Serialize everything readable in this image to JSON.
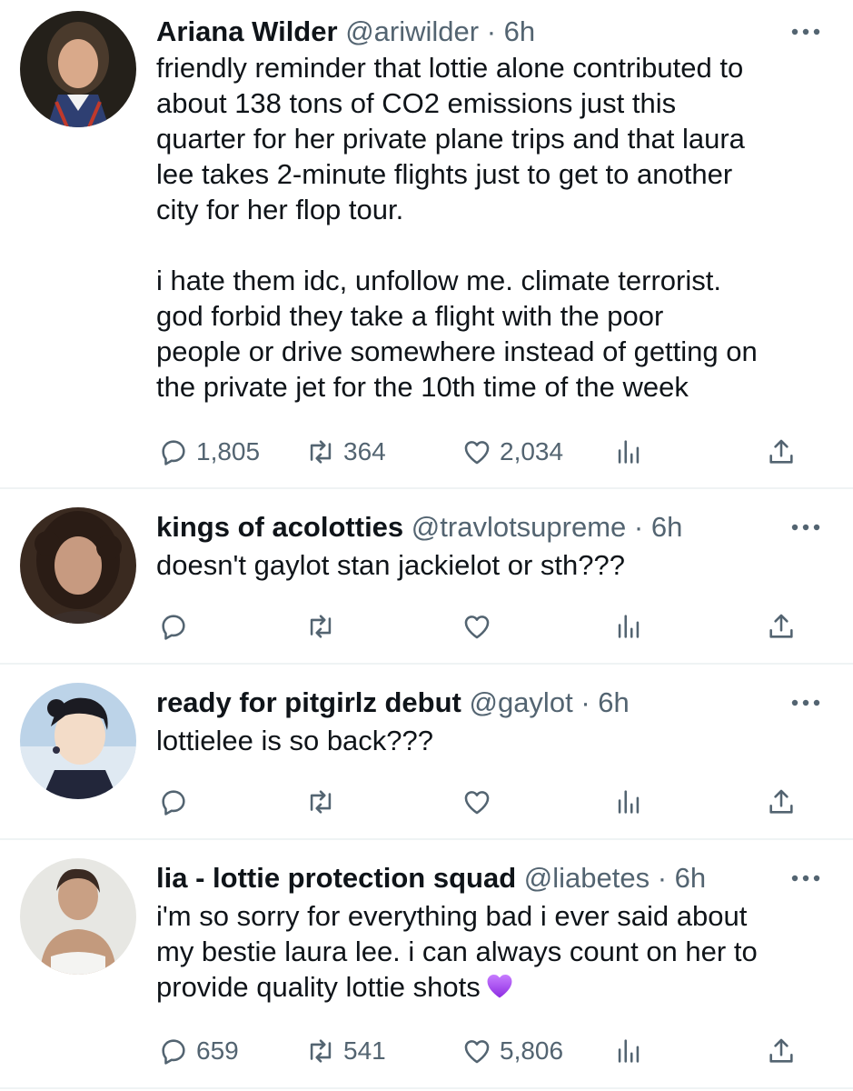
{
  "tweets": [
    {
      "name": "Ariana Wilder",
      "handle": "@ariwilder",
      "dot": "·",
      "time": "6h",
      "lines": [
        "friendly reminder that lottie alone contributed to",
        "about 138 tons of CO2 emissions just this",
        "quarter for her private plane trips and that laura",
        "lee takes 2-minute flights just to get to another",
        "city for her flop tour.",
        "",
        "i hate them idc, unfollow me. climate terrorist.",
        "god forbid they take a flight with the poor",
        "people or drive somewhere instead of getting on",
        "the private jet for the 10th time of the week"
      ],
      "replies": "1,805",
      "retweets": "364",
      "likes": "2,034"
    },
    {
      "name": "kings of acolotties",
      "handle": "@travlotsupreme",
      "dot": "·",
      "time": "6h",
      "lines": [
        "doesn't gaylot stan jackielot or sth???"
      ],
      "replies": "",
      "retweets": "",
      "likes": ""
    },
    {
      "name": "ready for pitgirlz debut",
      "handle": "@gaylot",
      "dot": "·",
      "time": "6h",
      "lines": [
        "lottielee is so back???"
      ],
      "replies": "",
      "retweets": "",
      "likes": ""
    },
    {
      "name": "lia - lottie protection squad",
      "handle": "@liabetes",
      "dot": "·",
      "time": "6h",
      "lines": [
        "i'm so sorry for everything bad i ever said about",
        "my bestie laura lee. i can always count on her to",
        "provide quality lottie shots"
      ],
      "emoji": "purple-heart-emoji",
      "replies": "659",
      "retweets": "541",
      "likes": "5,806"
    }
  ],
  "icons": {
    "reply": "reply-icon",
    "retweet": "retweet-icon",
    "like": "like-icon",
    "views": "views-icon",
    "share": "share-icon",
    "more": "more-icon"
  },
  "colors": {
    "text": "#0f1419",
    "secondary": "#536471",
    "divider": "#eff3f4",
    "emoji": "#a64de0"
  }
}
